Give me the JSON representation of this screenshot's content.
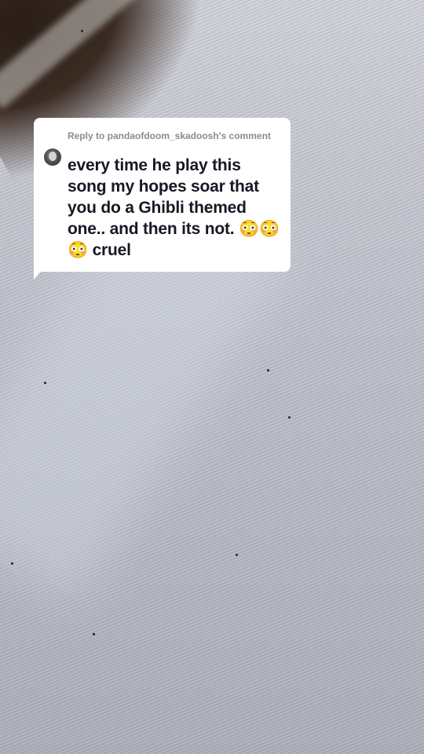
{
  "reply_card": {
    "reply_label": "Reply to pandaofdoom_skadoosh's comment",
    "comment_text": "every time he play this song my hopes soar that you do a Ghibli themed one.. and then its not. 😳😳😳 cruel"
  },
  "colors": {
    "card_background": "#ffffff",
    "comment_text": "#161823",
    "reply_label": "#8b8b90",
    "canvas": "#bdc0ca"
  },
  "icons": {
    "avatar": "user-avatar",
    "emoji": "flushed-face-emoji"
  }
}
